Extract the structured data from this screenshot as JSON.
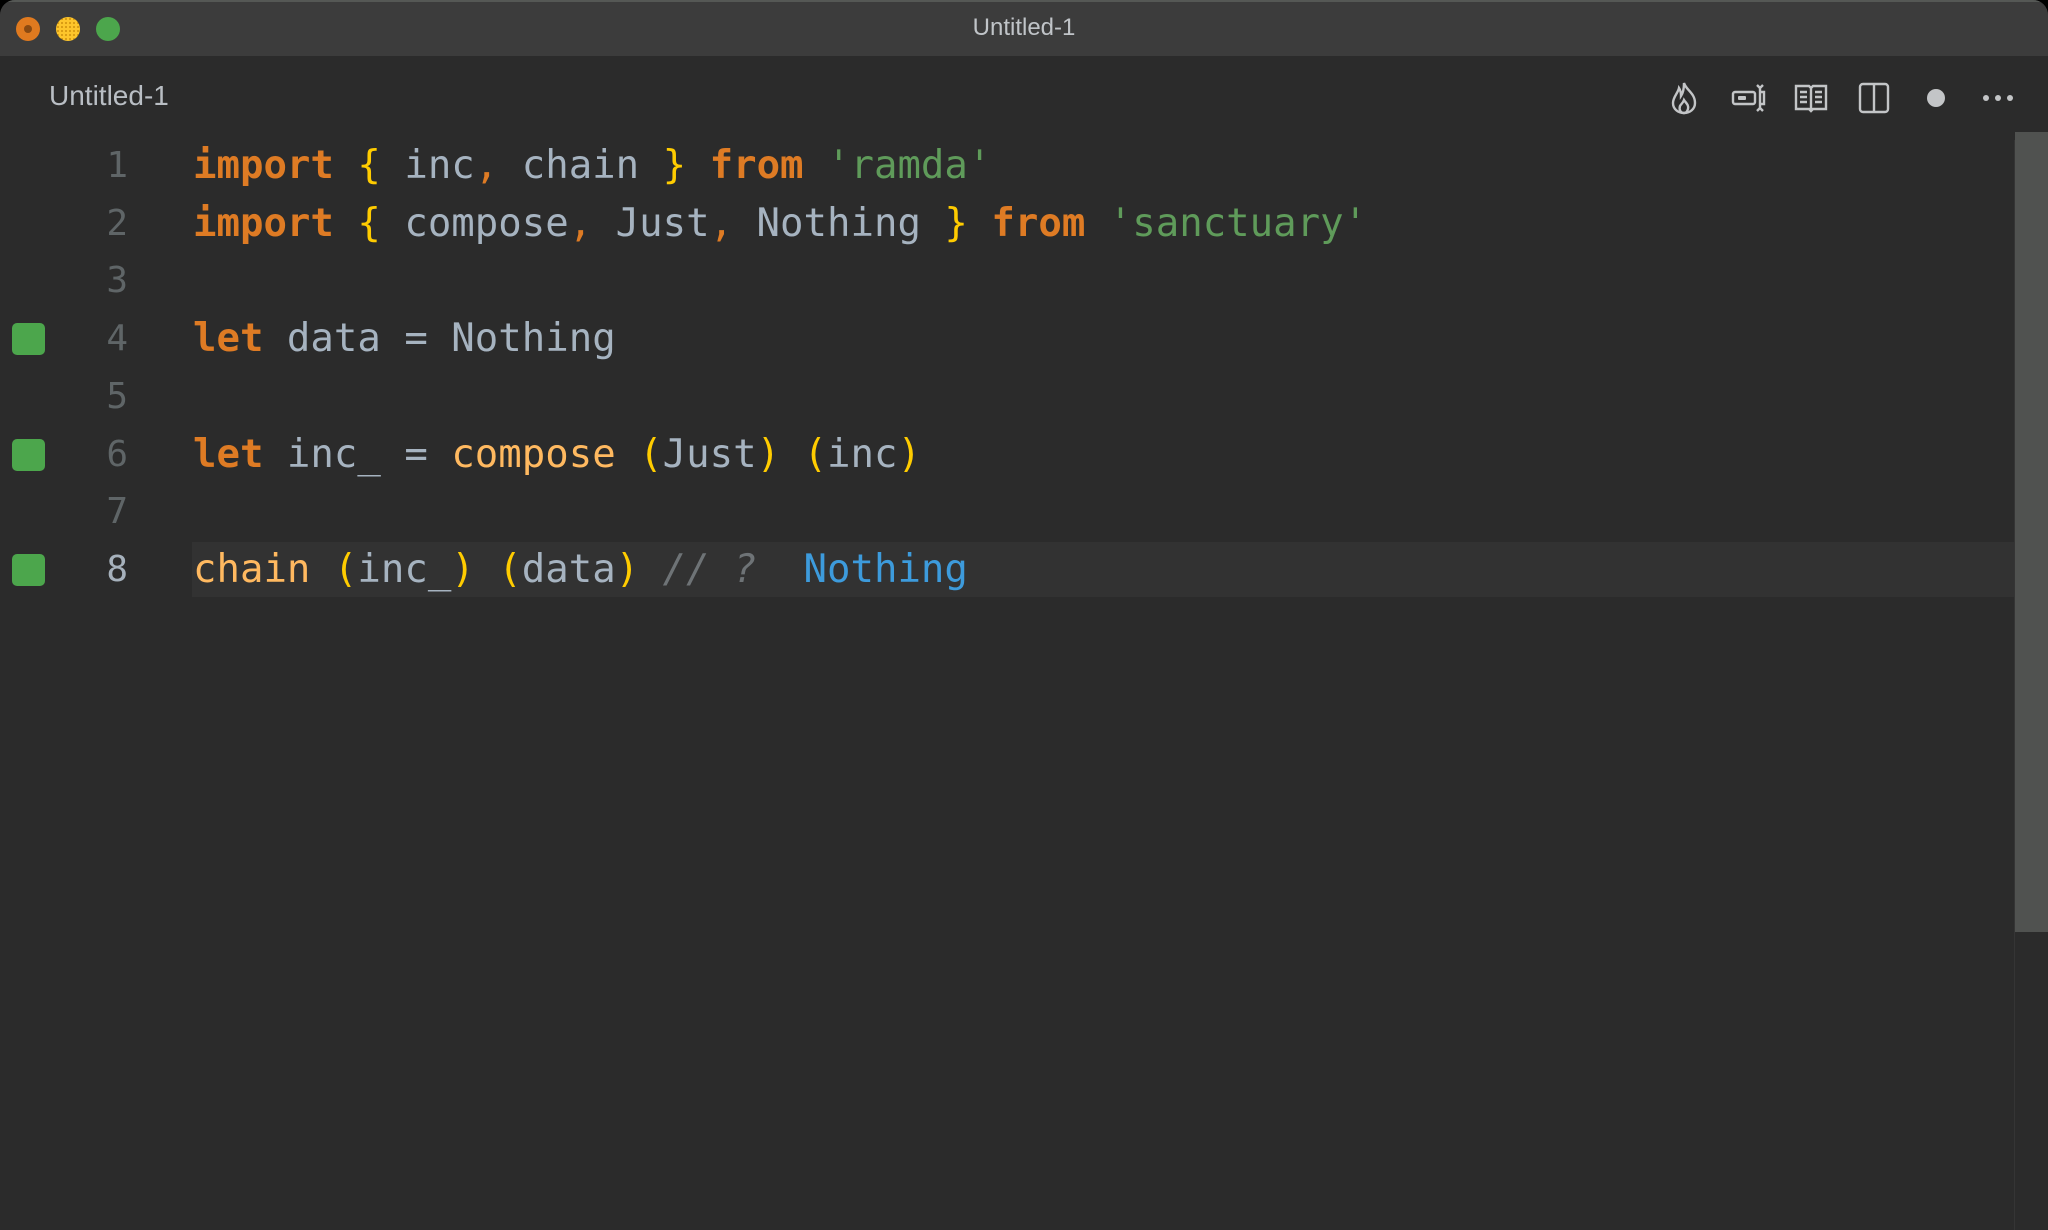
{
  "window": {
    "title": "Untitled-1",
    "traffic_lights": [
      "close",
      "minimize",
      "maximize"
    ]
  },
  "tab": {
    "label": "Untitled-1"
  },
  "toolbar": {
    "icons": [
      {
        "name": "flame-icon",
        "label": "Quokka"
      },
      {
        "name": "text-cursor-box-icon",
        "label": "Inline value"
      },
      {
        "name": "open-book-icon",
        "label": "Preview"
      },
      {
        "name": "split-editor-icon",
        "label": "Split Editor"
      },
      {
        "name": "unsaved-dot-icon",
        "label": "Unsaved changes"
      },
      {
        "name": "more-actions-icon",
        "label": "More Actions"
      }
    ]
  },
  "editor": {
    "language": "javascript",
    "current_line": 8,
    "lines": [
      {
        "number": "1",
        "marker": false,
        "tokens": [
          {
            "t": "import",
            "c": "kw"
          },
          {
            "t": " ",
            "c": "id"
          },
          {
            "t": "{",
            "c": "br"
          },
          {
            "t": " inc",
            "c": "id"
          },
          {
            "t": ",",
            "c": "pn"
          },
          {
            "t": " chain ",
            "c": "id"
          },
          {
            "t": "}",
            "c": "br"
          },
          {
            "t": " ",
            "c": "id"
          },
          {
            "t": "from",
            "c": "kw"
          },
          {
            "t": " ",
            "c": "id"
          },
          {
            "t": "'ramda'",
            "c": "str"
          }
        ]
      },
      {
        "number": "2",
        "marker": false,
        "tokens": [
          {
            "t": "import",
            "c": "kw"
          },
          {
            "t": " ",
            "c": "id"
          },
          {
            "t": "{",
            "c": "br"
          },
          {
            "t": " compose",
            "c": "id"
          },
          {
            "t": ",",
            "c": "pn"
          },
          {
            "t": " Just",
            "c": "id"
          },
          {
            "t": ",",
            "c": "pn"
          },
          {
            "t": " Nothing ",
            "c": "id"
          },
          {
            "t": "}",
            "c": "br"
          },
          {
            "t": " ",
            "c": "id"
          },
          {
            "t": "from",
            "c": "kw"
          },
          {
            "t": " ",
            "c": "id"
          },
          {
            "t": "'sanctuary'",
            "c": "str"
          }
        ]
      },
      {
        "number": "3",
        "marker": false,
        "tokens": []
      },
      {
        "number": "4",
        "marker": true,
        "tokens": [
          {
            "t": "let",
            "c": "kw"
          },
          {
            "t": " data ",
            "c": "id"
          },
          {
            "t": "=",
            "c": "op"
          },
          {
            "t": " Nothing",
            "c": "id"
          }
        ]
      },
      {
        "number": "5",
        "marker": false,
        "tokens": []
      },
      {
        "number": "6",
        "marker": true,
        "tokens": [
          {
            "t": "let",
            "c": "kw"
          },
          {
            "t": " inc_ ",
            "c": "id"
          },
          {
            "t": "=",
            "c": "op"
          },
          {
            "t": " ",
            "c": "id"
          },
          {
            "t": "compose",
            "c": "fn"
          },
          {
            "t": " ",
            "c": "id"
          },
          {
            "t": "(",
            "c": "br"
          },
          {
            "t": "Just",
            "c": "id"
          },
          {
            "t": ")",
            "c": "br"
          },
          {
            "t": " ",
            "c": "id"
          },
          {
            "t": "(",
            "c": "br"
          },
          {
            "t": "inc",
            "c": "id"
          },
          {
            "t": ")",
            "c": "br"
          }
        ]
      },
      {
        "number": "7",
        "marker": false,
        "tokens": []
      },
      {
        "number": "8",
        "marker": true,
        "tokens": [
          {
            "t": "chain",
            "c": "fn"
          },
          {
            "t": " ",
            "c": "id"
          },
          {
            "t": "(",
            "c": "br"
          },
          {
            "t": "inc_",
            "c": "id"
          },
          {
            "t": ")",
            "c": "br"
          },
          {
            "t": " ",
            "c": "id"
          },
          {
            "t": "(",
            "c": "br"
          },
          {
            "t": "data",
            "c": "id"
          },
          {
            "t": ")",
            "c": "br"
          },
          {
            "t": " ",
            "c": "id"
          },
          {
            "t": "// ?",
            "c": "cm"
          },
          {
            "t": "  ",
            "c": "id"
          },
          {
            "t": "Nothing",
            "c": "val"
          }
        ]
      }
    ]
  },
  "colors": {
    "editor_bg": "#2b2b2b",
    "titlebar_bg": "#3c3c3c",
    "keyword": "#de7b24",
    "bracket": "#ffcc00",
    "identifier": "#a6b3c0",
    "string": "#5f9b5a",
    "function": "#ffb960",
    "comment": "#6e7376",
    "inline_value": "#3d9bdc",
    "coverage_marker": "#4ca64c"
  }
}
